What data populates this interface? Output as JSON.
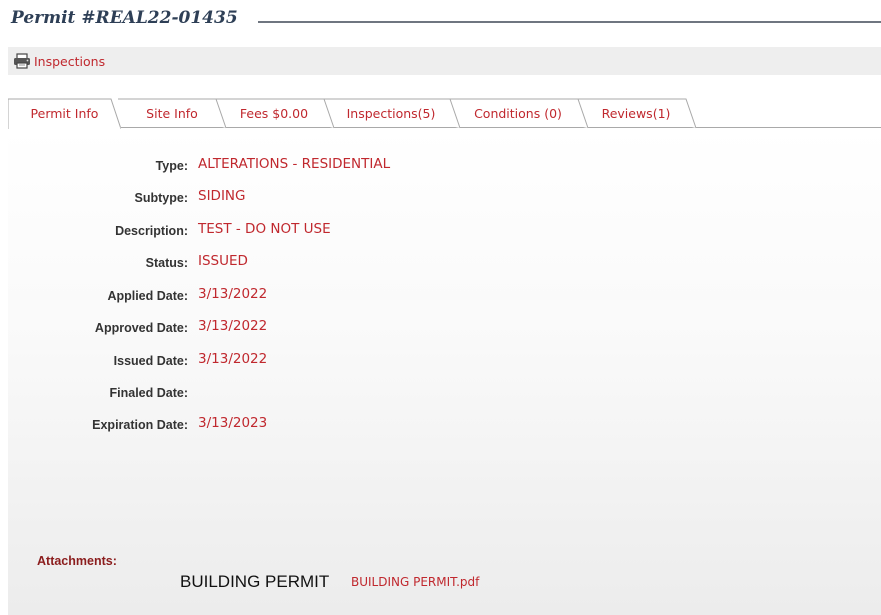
{
  "permit": {
    "title": "Permit #REAL22-01435"
  },
  "toolbar": {
    "print_icon": "printer-icon",
    "inspections_link": "Inspections"
  },
  "tabs": [
    {
      "label": "Permit Info",
      "active": true
    },
    {
      "label": "Site Info",
      "active": false
    },
    {
      "label": "Fees $0.00",
      "active": false
    },
    {
      "label": "Inspections(5)",
      "active": false
    },
    {
      "label": "Conditions (0)",
      "active": false
    },
    {
      "label": "Reviews(1)",
      "active": false
    }
  ],
  "fields": [
    {
      "label": "Type:",
      "value": "ALTERATIONS - RESIDENTIAL"
    },
    {
      "label": "Subtype:",
      "value": "SIDING"
    },
    {
      "label": "Description:",
      "value": "TEST - DO NOT USE"
    },
    {
      "label": "Status:",
      "value": "ISSUED"
    },
    {
      "label": "Applied Date:",
      "value": "3/13/2022"
    },
    {
      "label": "Approved Date:",
      "value": "3/13/2022"
    },
    {
      "label": "Issued Date:",
      "value": "3/13/2022"
    },
    {
      "label": "Finaled Date:",
      "value": ""
    },
    {
      "label": "Expiration Date:",
      "value": "3/13/2023"
    }
  ],
  "attachments": {
    "label": "Attachments:",
    "items": [
      {
        "name": "BUILDING PERMIT",
        "file": "BUILDING PERMIT.pdf"
      }
    ]
  },
  "colors": {
    "accent": "#c0282e",
    "title": "#2e3f56",
    "label": "#333333",
    "attachments_label": "#8b1d1d"
  }
}
